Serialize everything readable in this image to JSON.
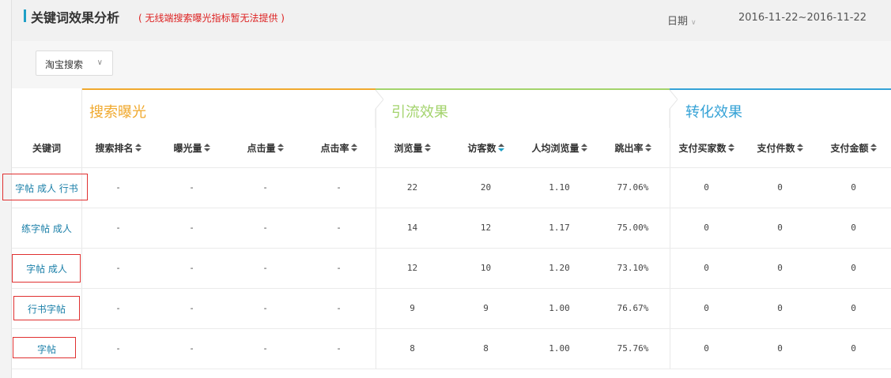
{
  "header": {
    "title": "关键词效果分析",
    "note": "( 无线端搜索曝光指标暂无法提供 )",
    "date_label": "日期",
    "date_range": "2016-11-22~2016-11-22"
  },
  "filter": {
    "selected": "淘宝搜索"
  },
  "groups": [
    {
      "title": "搜索曝光",
      "color": "#f0a92e"
    },
    {
      "title": "引流效果",
      "color": "#a3d36c"
    },
    {
      "title": "转化效果",
      "color": "#35a2d6"
    }
  ],
  "columns": [
    "关键词",
    "搜索排名",
    "曝光量",
    "点击量",
    "点击率",
    "浏览量",
    "访客数",
    "人均浏览量",
    "跳出率",
    "支付买家数",
    "支付件数",
    "支付金额"
  ],
  "rows": [
    {
      "keyword": "字帖 成人 行书",
      "rank": "-",
      "exposure": "-",
      "clicks": "-",
      "ctr": "-",
      "pv": "22",
      "uv": "20",
      "avg_pv": "1.10",
      "bounce": "77.06%",
      "buyers": "0",
      "items": "0",
      "amount": "0"
    },
    {
      "keyword": "练字帖 成人",
      "rank": "-",
      "exposure": "-",
      "clicks": "-",
      "ctr": "-",
      "pv": "14",
      "uv": "12",
      "avg_pv": "1.17",
      "bounce": "75.00%",
      "buyers": "0",
      "items": "0",
      "amount": "0"
    },
    {
      "keyword": "字帖 成人",
      "rank": "-",
      "exposure": "-",
      "clicks": "-",
      "ctr": "-",
      "pv": "12",
      "uv": "10",
      "avg_pv": "1.20",
      "bounce": "73.10%",
      "buyers": "0",
      "items": "0",
      "amount": "0"
    },
    {
      "keyword": "行书字帖",
      "rank": "-",
      "exposure": "-",
      "clicks": "-",
      "ctr": "-",
      "pv": "9",
      "uv": "9",
      "avg_pv": "1.00",
      "bounce": "76.67%",
      "buyers": "0",
      "items": "0",
      "amount": "0"
    },
    {
      "keyword": "字帖",
      "rank": "-",
      "exposure": "-",
      "clicks": "-",
      "ctr": "-",
      "pv": "8",
      "uv": "8",
      "avg_pv": "1.00",
      "bounce": "75.76%",
      "buyers": "0",
      "items": "0",
      "amount": "0"
    }
  ]
}
